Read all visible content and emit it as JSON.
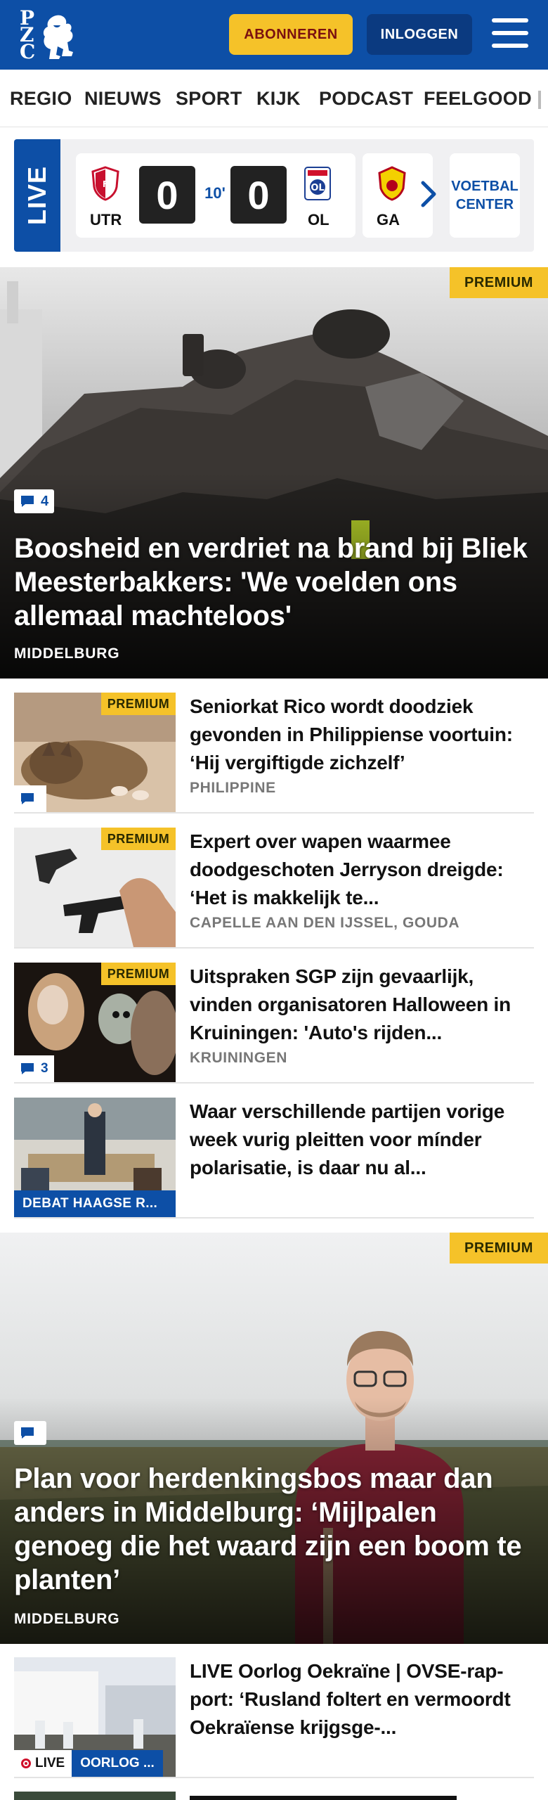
{
  "header": {
    "logo_letters": [
      "P",
      "Z",
      "C"
    ],
    "subscribe_label": "ABONNEREN",
    "login_label": "INLOGGEN",
    "brand_color": "#0d4fa6",
    "accent_color": "#f5c229"
  },
  "nav": {
    "items": [
      "REGIO",
      "NIEUWS",
      "SPORT",
      "KIJK",
      "PODCAST",
      "FEELGOOD"
    ]
  },
  "live": {
    "tag": "LIVE",
    "match": {
      "home": "UTR",
      "away": "OL",
      "home_score": "0",
      "away_score": "0",
      "minute": "10'"
    },
    "next_team": "GA",
    "center_label": "VOETBAL CENTER"
  },
  "hero1": {
    "badge": "PREMIUM",
    "comments": "4",
    "title": "Boosheid en verdriet na brand bij Bliek Meesterbakkers: 'We voelden ons allemaal machteloos'",
    "location": "MIDDELBURG"
  },
  "list1": [
    {
      "badge": "PREMIUM",
      "comments": "",
      "title": "Seniorkat Rico wordt doodziek gevonden in Philippiense voortuin: ‘Hij vergiftigde zichzelf’",
      "location": "PHILIPPINE"
    },
    {
      "badge": "PREMIUM",
      "title": "Expert over wapen waarmee doodgeschoten Jerryson dreigde: ‘Het is makkelijk te...",
      "location": "CAPELLE AAN DEN IJSSEL, GOUDA"
    },
    {
      "badge": "PREMIUM",
      "comments": "3",
      "title": "Uitspraken SGP zijn gevaarlijk, vinden organisatoren Halloween in Kruiningen: 'Auto's rijden...",
      "location": "KRUININGEN"
    },
    {
      "label": "DEBAT HAAGSE R...",
      "title": "Waar verschillende partijen vorige week vurig pleitten voor mínder polarisatie, is daar nu al..."
    }
  ],
  "hero2": {
    "badge": "PREMIUM",
    "comments": "",
    "title": "Plan voor herdenkingsbos maar dan anders in Middelburg: ‘Mijlpalen genoeg die het waard zijn een boom te planten’",
    "location": "MIDDELBURG"
  },
  "list2": [
    {
      "live": "LIVE",
      "label": "OORLOG ...",
      "title": "LIVE Oorlog Oekraïne | OVSE-rap-port: ‘Rusland foltert en vermoordt Oekraïense krijgsge-..."
    }
  ]
}
